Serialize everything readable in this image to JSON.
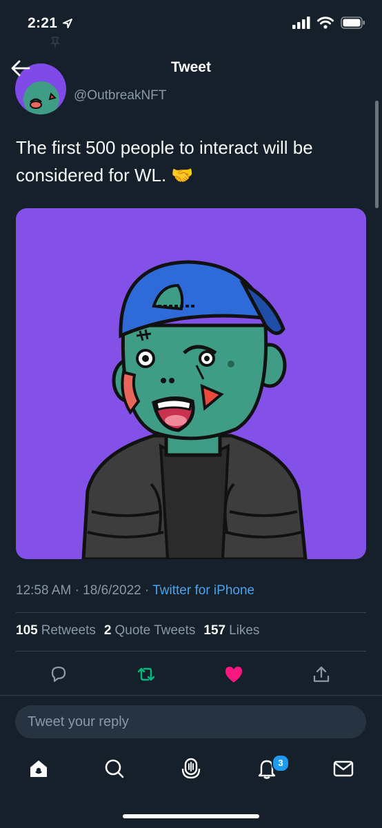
{
  "status": {
    "time": "2:21"
  },
  "header": {
    "title": "Tweet"
  },
  "tweet": {
    "handle": "@OutbreakNFT",
    "text": "The first 500 people to interact will be considered for WL. 🤝",
    "time": "12:58 AM",
    "date": "18/6/2022",
    "source": "Twitter for iPhone",
    "stats": {
      "retweets": "105",
      "retweets_label": "Retweets",
      "quotes": "2",
      "quotes_label": "Quote Tweets",
      "likes": "157",
      "likes_label": "Likes"
    },
    "liked": true
  },
  "reply": {
    "placeholder": "Tweet your reply"
  },
  "tabs": [
    {
      "name": "home-icon",
      "active": true
    },
    {
      "name": "search-icon"
    },
    {
      "name": "spaces-icon"
    },
    {
      "name": "notifications-icon",
      "badge": "3"
    },
    {
      "name": "messages-icon"
    }
  ],
  "colors": {
    "background": "#15202b",
    "accent": "#1d9bf0",
    "like": "#f91880",
    "retweet": "#00ba7c",
    "media_background": "#8451e8"
  }
}
